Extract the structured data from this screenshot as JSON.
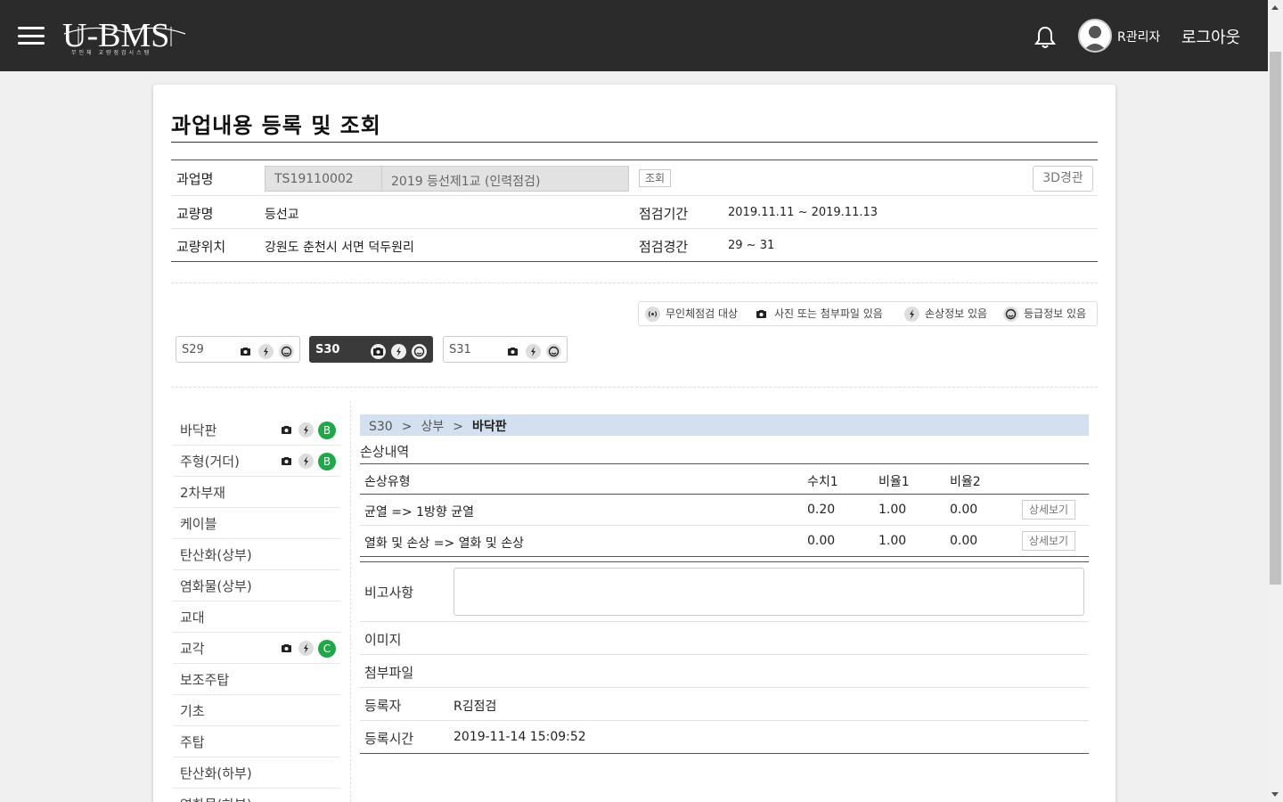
{
  "header": {
    "logo_text": "U-BMS",
    "logo_subtitle": "무인체 교량점검시스템",
    "username": "R관리자",
    "logout_label": "로그아웃"
  },
  "page": {
    "title": "과업내용 등록 및 조회"
  },
  "info": {
    "task_label": "과업명",
    "task_code": "TS19110002",
    "task_name": "2019 등선제1교 (인력점검)",
    "search_label": "조회",
    "view3d_label": "3D경관",
    "bridge_label": "교량명",
    "bridge_value": "등선교",
    "period_label": "점검기간",
    "period_value": "2019.11.11 ~ 2019.11.13",
    "location_label": "교량위치",
    "location_value": "강원도 춘천시 서면 덕두원리",
    "span_range_label": "점검경간",
    "span_range_value": "29 ~ 31"
  },
  "legend": {
    "drone": "무인체점검 대상",
    "photo": "사진 또는 첨부파일 있음",
    "damage": "손상정보 있음",
    "grade": "등급정보 있음"
  },
  "spans": [
    {
      "label": "S29",
      "active": false
    },
    {
      "label": "S30",
      "active": true
    },
    {
      "label": "S31",
      "active": false
    }
  ],
  "members": [
    {
      "label": "바닥판",
      "grade": "B"
    },
    {
      "label": "주형(거더)",
      "grade": "B"
    },
    {
      "label": "2차부재"
    },
    {
      "label": "케이블"
    },
    {
      "label": "탄산화(상부)"
    },
    {
      "label": "염화물(상부)"
    },
    {
      "label": "교대"
    },
    {
      "label": "교각",
      "grade": "C"
    },
    {
      "label": "보조주탑"
    },
    {
      "label": "기초"
    },
    {
      "label": "주탑"
    },
    {
      "label": "탄산화(하부)"
    },
    {
      "label": "염화물(하부)"
    }
  ],
  "breadcrumb": {
    "span": "S30",
    "sep": ">",
    "section": "상부",
    "member": "바닥판"
  },
  "damage": {
    "title": "손상내역",
    "headers": {
      "type": "손상유형",
      "value1": "수치1",
      "ratio1": "비율1",
      "ratio2": "비율2"
    },
    "rows": [
      {
        "type": "균열 => 1방향 균열",
        "value1": "0.20",
        "ratio1": "1.00",
        "ratio2": "0.00",
        "action": "상세보기"
      },
      {
        "type": "열화 및 손상 => 열화 및 손상",
        "value1": "0.00",
        "ratio1": "1.00",
        "ratio2": "0.00",
        "action": "상세보기"
      }
    ]
  },
  "meta": {
    "remark_label": "비고사항",
    "remark_value": "",
    "image_label": "이미지",
    "attach_label": "첨부파일",
    "registrant_label": "등록자",
    "registrant_value": "R김점검",
    "regtime_label": "등록시간",
    "regtime_value": "2019-11-14 15:09:52"
  },
  "colors": {
    "header_bg": "#2b2b2b",
    "breadcrumb_bg": "#d3e0ef",
    "grade_badge": "#21a64a"
  }
}
